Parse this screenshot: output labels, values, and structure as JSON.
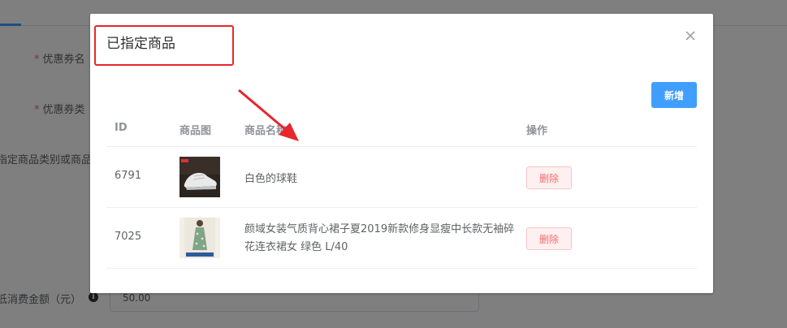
{
  "background": {
    "labels": {
      "coupon_name": "优惠券名",
      "coupon_type": "优惠券类",
      "product_scope": "指定商品类别或商品",
      "min_amount": "低消费金额（元）"
    },
    "required_mark": "*",
    "min_amount_value": "50.00",
    "info_glyph": "i"
  },
  "dialog": {
    "title": "已指定商品",
    "add_label": "新增",
    "columns": {
      "id": "ID",
      "image": "商品图",
      "name": "商品名称",
      "action": "操作"
    },
    "rows": [
      {
        "id": "6791",
        "name": "白色的球鞋",
        "delete_label": "删除"
      },
      {
        "id": "7025",
        "name": "颜域女装气质背心裙子夏2019新款修身显瘦中长款无袖碎花连衣裙女 绿色 L/40",
        "delete_label": "删除"
      }
    ]
  },
  "colors": {
    "primary": "#409eff",
    "danger": "#f56c6c",
    "annotation": "#e8262b"
  }
}
